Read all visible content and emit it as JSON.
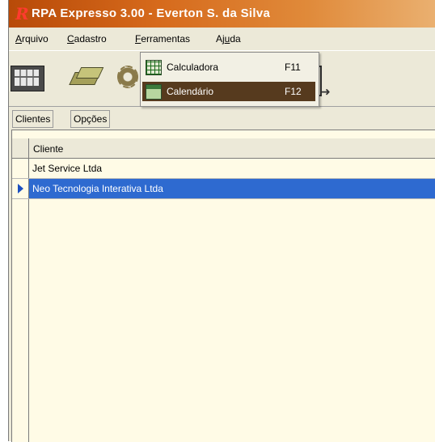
{
  "window": {
    "title": "RPA Expresso 3.00 - Everton S. da Silva",
    "logo_glyph": "R",
    "accent": "#d66a1c"
  },
  "menu": {
    "items": [
      {
        "first": "A",
        "rest": "rquivo"
      },
      {
        "first": "C",
        "rest": "adastro"
      },
      {
        "first": "F",
        "rest": "erramentas"
      },
      {
        "pre": "Aj",
        "acc": "u",
        "rest": "da"
      }
    ]
  },
  "toolbar": {
    "icons": [
      "calendar-icon",
      "boxes-icon",
      "gear-icon"
    ]
  },
  "dropdown": {
    "items": [
      {
        "label": "Calculadora",
        "shortcut": "F11",
        "icon": "calculator-icon"
      },
      {
        "label": "Calendário",
        "shortcut": "F12",
        "icon": "calendar-icon",
        "selected": true
      }
    ]
  },
  "tabs": [
    "Clientes",
    "Opções"
  ],
  "grid": {
    "header": "Cliente",
    "rows": [
      "Jet Service Ltda",
      "Neo Tecnologia Interativa Ltda"
    ],
    "selected_index": 1,
    "selection_color": "#2e6ad0"
  }
}
